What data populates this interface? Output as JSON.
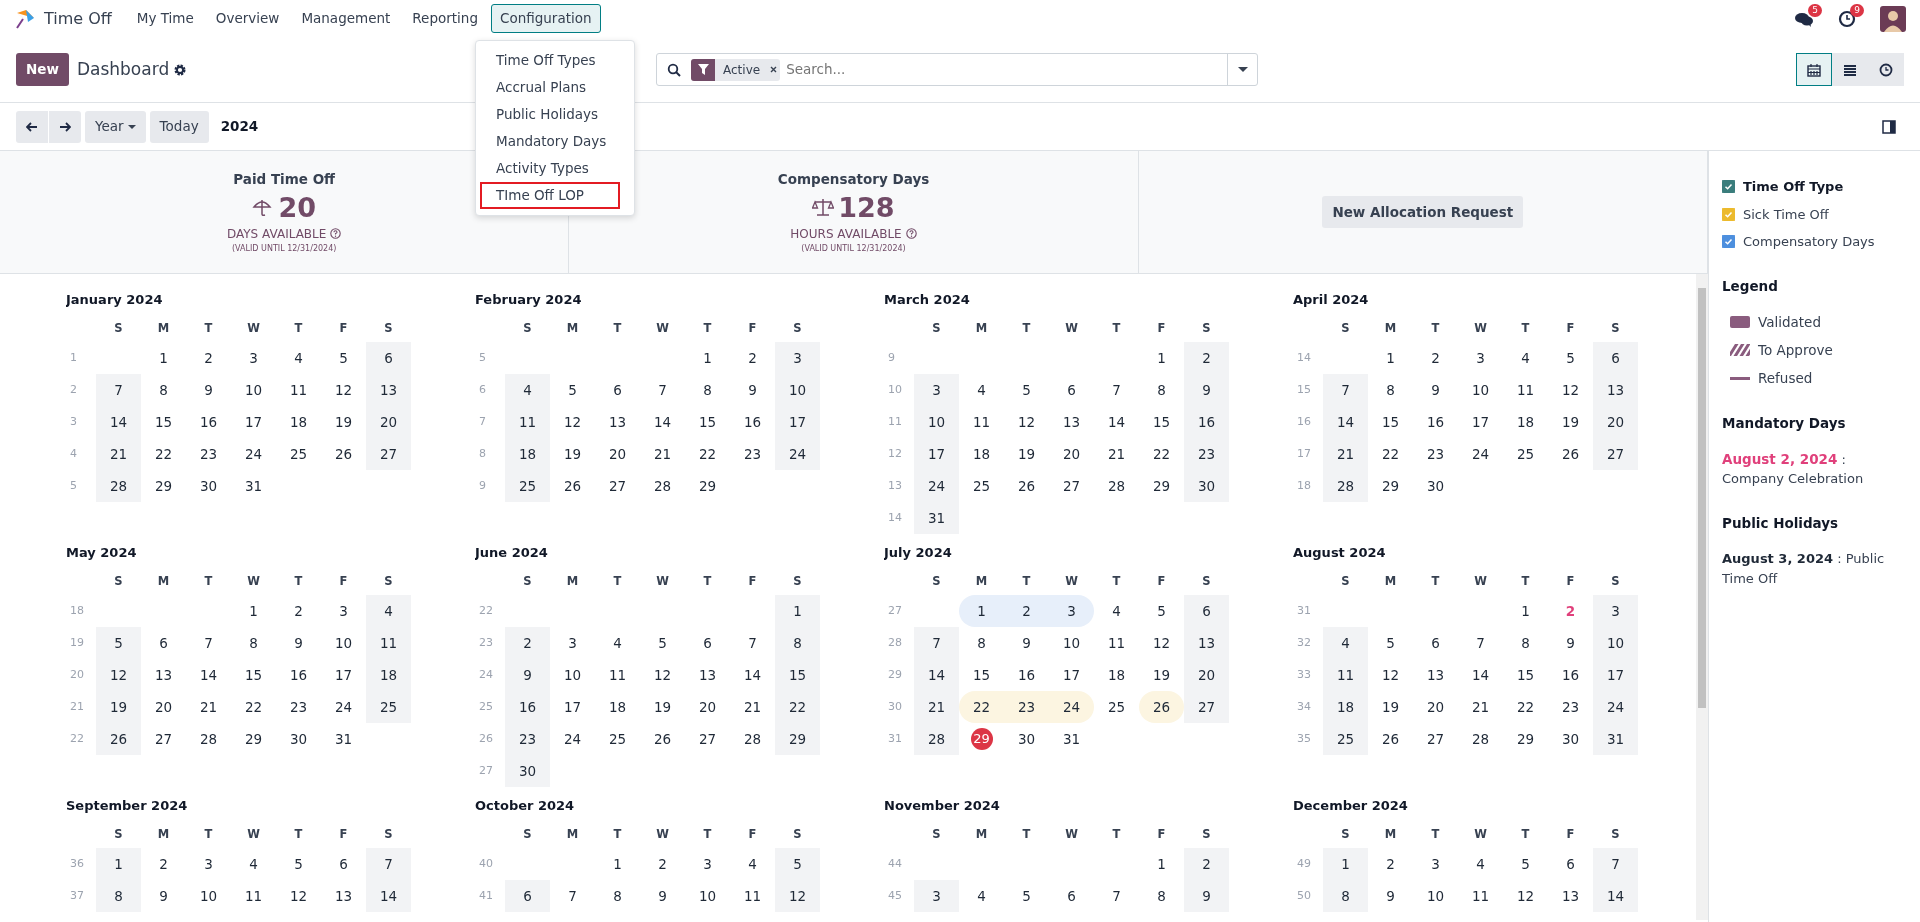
{
  "navbar": {
    "app_name": "Time Off",
    "menu": [
      {
        "label": "My Time",
        "selected": false
      },
      {
        "label": "Overview",
        "selected": false
      },
      {
        "label": "Management",
        "selected": false
      },
      {
        "label": "Reporting",
        "selected": false
      },
      {
        "label": "Configuration",
        "selected": true
      }
    ],
    "messages_count": "5",
    "activities_count": "9"
  },
  "config_menu": [
    {
      "label": "Time Off Types",
      "highlighted": false
    },
    {
      "label": "Accrual Plans",
      "highlighted": false
    },
    {
      "label": "Public Holidays",
      "highlighted": false
    },
    {
      "label": "Mandatory Days",
      "highlighted": false
    },
    {
      "label": "Activity Types",
      "highlighted": false
    },
    {
      "label": "TIme Off LOP",
      "highlighted": true
    }
  ],
  "control_panel": {
    "new_button": "New",
    "title": "Dashboard",
    "search": {
      "facet": "Active",
      "placeholder": "Search..."
    },
    "views": [
      {
        "kind": "calendar",
        "selected": true
      },
      {
        "kind": "list",
        "selected": false
      },
      {
        "kind": "activity",
        "selected": false
      }
    ]
  },
  "date_bar": {
    "scale": "Year",
    "today": "Today",
    "period": "2024"
  },
  "summary": [
    {
      "kind": "allocation",
      "title": "Paid Time Off",
      "value": "20",
      "unit": "DAYS AVAILABLE",
      "validity": "(VALID UNTIL 12/31/2024)"
    },
    {
      "kind": "allocation",
      "title": "Compensatory Days",
      "value": "128",
      "unit": "HOURS AVAILABLE",
      "validity": "(VALID UNTIL 12/31/2024)"
    },
    {
      "kind": "action",
      "label": "New Allocation Request"
    }
  ],
  "months": [
    {
      "title": "January 2024",
      "weekdays": [
        "S",
        "M",
        "T",
        "W",
        "T",
        "F",
        "S"
      ],
      "weeks": [
        {
          "week": "1",
          "days": [
            "1",
            "2",
            "3",
            "4",
            "5",
            "6"
          ]
        },
        {
          "week": "2",
          "days": [
            "7",
            "8",
            "9",
            "10",
            "11",
            "12",
            "13"
          ]
        },
        {
          "week": "3",
          "days": [
            "14",
            "15",
            "16",
            "17",
            "18",
            "19",
            "20"
          ]
        },
        {
          "week": "4",
          "days": [
            "21",
            "22",
            "23",
            "24",
            "25",
            "26",
            "27"
          ]
        },
        {
          "week": "5",
          "days": [
            "28",
            "29",
            "30",
            "31"
          ]
        }
      ]
    },
    {
      "title": "February 2024",
      "weekdays": [
        "S",
        "M",
        "T",
        "W",
        "T",
        "F",
        "S"
      ],
      "weeks": [
        {
          "week": "5",
          "days": [
            "1",
            "2",
            "3"
          ]
        },
        {
          "week": "6",
          "days": [
            "4",
            "5",
            "6",
            "7",
            "8",
            "9",
            "10"
          ]
        },
        {
          "week": "7",
          "days": [
            "11",
            "12",
            "13",
            "14",
            "15",
            "16",
            "17"
          ]
        },
        {
          "week": "8",
          "days": [
            "18",
            "19",
            "20",
            "21",
            "22",
            "23",
            "24"
          ]
        },
        {
          "week": "9",
          "days": [
            "25",
            "26",
            "27",
            "28",
            "29"
          ]
        }
      ]
    },
    {
      "title": "March 2024",
      "weekdays": [
        "S",
        "M",
        "T",
        "W",
        "T",
        "F",
        "S"
      ],
      "weeks": [
        {
          "week": "9",
          "days": [
            "1",
            "2"
          ]
        },
        {
          "week": "10",
          "days": [
            "3",
            "4",
            "5",
            "6",
            "7",
            "8",
            "9"
          ]
        },
        {
          "week": "11",
          "days": [
            "10",
            "11",
            "12",
            "13",
            "14",
            "15",
            "16"
          ]
        },
        {
          "week": "12",
          "days": [
            "17",
            "18",
            "19",
            "20",
            "21",
            "22",
            "23"
          ]
        },
        {
          "week": "13",
          "days": [
            "24",
            "25",
            "26",
            "27",
            "28",
            "29",
            "30"
          ]
        },
        {
          "week": "14",
          "days": [
            "31"
          ]
        }
      ]
    },
    {
      "title": "April 2024",
      "weekdays": [
        "S",
        "M",
        "T",
        "W",
        "T",
        "F",
        "S"
      ],
      "weeks": [
        {
          "week": "14",
          "days": [
            "1",
            "2",
            "3",
            "4",
            "5",
            "6"
          ]
        },
        {
          "week": "15",
          "days": [
            "7",
            "8",
            "9",
            "10",
            "11",
            "12",
            "13"
          ]
        },
        {
          "week": "16",
          "days": [
            "14",
            "15",
            "16",
            "17",
            "18",
            "19",
            "20"
          ]
        },
        {
          "week": "17",
          "days": [
            "21",
            "22",
            "23",
            "24",
            "25",
            "26",
            "27"
          ]
        },
        {
          "week": "18",
          "days": [
            "28",
            "29",
            "30"
          ]
        }
      ]
    },
    {
      "title": "May 2024",
      "weekdays": [
        "S",
        "M",
        "T",
        "W",
        "T",
        "F",
        "S"
      ],
      "weeks": [
        {
          "week": "18",
          "days": [
            "1",
            "2",
            "3",
            "4"
          ]
        },
        {
          "week": "19",
          "days": [
            "5",
            "6",
            "7",
            "8",
            "9",
            "10",
            "11"
          ]
        },
        {
          "week": "20",
          "days": [
            "12",
            "13",
            "14",
            "15",
            "16",
            "17",
            "18"
          ]
        },
        {
          "week": "21",
          "days": [
            "19",
            "20",
            "21",
            "22",
            "23",
            "24",
            "25"
          ]
        },
        {
          "week": "22",
          "days": [
            "26",
            "27",
            "28",
            "29",
            "30",
            "31"
          ]
        }
      ]
    },
    {
      "title": "June 2024",
      "weekdays": [
        "S",
        "M",
        "T",
        "W",
        "T",
        "F",
        "S"
      ],
      "weeks": [
        {
          "week": "22",
          "days": [
            "1"
          ]
        },
        {
          "week": "23",
          "days": [
            "2",
            "3",
            "4",
            "5",
            "6",
            "7",
            "8"
          ]
        },
        {
          "week": "24",
          "days": [
            "9",
            "10",
            "11",
            "12",
            "13",
            "14",
            "15"
          ]
        },
        {
          "week": "25",
          "days": [
            "16",
            "17",
            "18",
            "19",
            "20",
            "21",
            "22"
          ]
        },
        {
          "week": "26",
          "days": [
            "23",
            "24",
            "25",
            "26",
            "27",
            "28",
            "29"
          ]
        },
        {
          "week": "27",
          "days": [
            "30"
          ]
        }
      ]
    },
    {
      "title": "July 2024",
      "weekdays": [
        "S",
        "M",
        "T",
        "W",
        "T",
        "F",
        "S"
      ],
      "weeks": [
        {
          "week": "27",
          "days": [
            {
              "day": "1",
              "color": "#e7effa"
            },
            {
              "day": "2",
              "color": "#e7effa"
            },
            {
              "day": "3",
              "color": "#e7effa"
            },
            "4",
            "5",
            "6"
          ]
        },
        {
          "week": "28",
          "days": [
            "7",
            "8",
            "9",
            "10",
            "11",
            "12",
            "13"
          ]
        },
        {
          "week": "29",
          "days": [
            "14",
            "15",
            "16",
            "17",
            "18",
            "19",
            "20"
          ]
        },
        {
          "week": "30",
          "days": [
            "21",
            {
              "day": "22",
              "color": "#fcf5e1"
            },
            {
              "day": "23",
              "color": "#fcf5e1"
            },
            {
              "day": "24",
              "color": "#fcf5e1"
            },
            "25",
            {
              "day": "26",
              "color": "#fcf5e1"
            },
            "27"
          ]
        },
        {
          "week": "31",
          "days": [
            "28",
            {
              "day": "29",
              "today": true
            },
            "30",
            "31"
          ]
        }
      ]
    },
    {
      "title": "August 2024",
      "weekdays": [
        "S",
        "M",
        "T",
        "W",
        "T",
        "F",
        "S"
      ],
      "weeks": [
        {
          "week": "31",
          "days": [
            "1",
            {
              "day": "2",
              "mandatory": true
            },
            "3"
          ]
        },
        {
          "week": "32",
          "days": [
            "4",
            "5",
            "6",
            "7",
            "8",
            "9",
            "10"
          ]
        },
        {
          "week": "33",
          "days": [
            "11",
            "12",
            "13",
            "14",
            "15",
            "16",
            "17"
          ]
        },
        {
          "week": "34",
          "days": [
            "18",
            "19",
            "20",
            "21",
            "22",
            "23",
            "24"
          ]
        },
        {
          "week": "35",
          "days": [
            "25",
            "26",
            "27",
            "28",
            "29",
            "30",
            "31"
          ]
        }
      ]
    },
    {
      "title": "September 2024",
      "weekdays": [
        "S",
        "M",
        "T",
        "W",
        "T",
        "F",
        "S"
      ],
      "weeks": [
        {
          "week": "36",
          "days": [
            "1",
            "2",
            "3",
            "4",
            "5",
            "6",
            "7"
          ]
        },
        {
          "week": "37",
          "days": [
            "8",
            "9",
            "10",
            "11",
            "12",
            "13",
            "14"
          ]
        }
      ]
    },
    {
      "title": "October 2024",
      "weekdays": [
        "S",
        "M",
        "T",
        "W",
        "T",
        "F",
        "S"
      ],
      "weeks": [
        {
          "week": "40",
          "days": [
            "1",
            "2",
            "3",
            "4",
            "5"
          ]
        },
        {
          "week": "41",
          "days": [
            "6",
            "7",
            "8",
            "9",
            "10",
            "11",
            "12"
          ]
        }
      ]
    },
    {
      "title": "November 2024",
      "weekdays": [
        "S",
        "M",
        "T",
        "W",
        "T",
        "F",
        "S"
      ],
      "weeks": [
        {
          "week": "44",
          "days": [
            "1",
            "2"
          ]
        },
        {
          "week": "45",
          "days": [
            "3",
            "4",
            "5",
            "6",
            "7",
            "8",
            "9"
          ]
        }
      ]
    },
    {
      "title": "December 2024",
      "weekdays": [
        "S",
        "M",
        "T",
        "W",
        "T",
        "F",
        "S"
      ],
      "weeks": [
        {
          "week": "49",
          "days": [
            "1",
            "2",
            "3",
            "4",
            "5",
            "6",
            "7"
          ]
        },
        {
          "week": "50",
          "days": [
            "8",
            "9",
            "10",
            "11",
            "12",
            "13",
            "14"
          ]
        }
      ]
    }
  ],
  "sidebar": {
    "filters": [
      {
        "label": "Time Off Type",
        "checked": true,
        "color": "#3a7d7c",
        "kind": "all"
      },
      {
        "label": "Sick Time Off",
        "checked": true,
        "color": "#ecba2d",
        "kind": "type"
      },
      {
        "label": "Compensatory Days",
        "checked": true,
        "color": "#4d8fde",
        "kind": "type"
      }
    ],
    "legend_title": "Legend",
    "legend": [
      {
        "kind": "validated",
        "label": "Validated"
      },
      {
        "kind": "to_approve",
        "label": "To Approve"
      },
      {
        "kind": "refused",
        "label": "Refused"
      }
    ],
    "mandatory_title": "Mandatory Days",
    "mandatory_days": [
      {
        "date": "August 2, 2024",
        "name": ": Company Celebration"
      }
    ],
    "holidays_title": "Public Holidays",
    "holidays": [
      {
        "date": "August 3, 2024",
        "name": ": Public Time Off"
      }
    ]
  }
}
